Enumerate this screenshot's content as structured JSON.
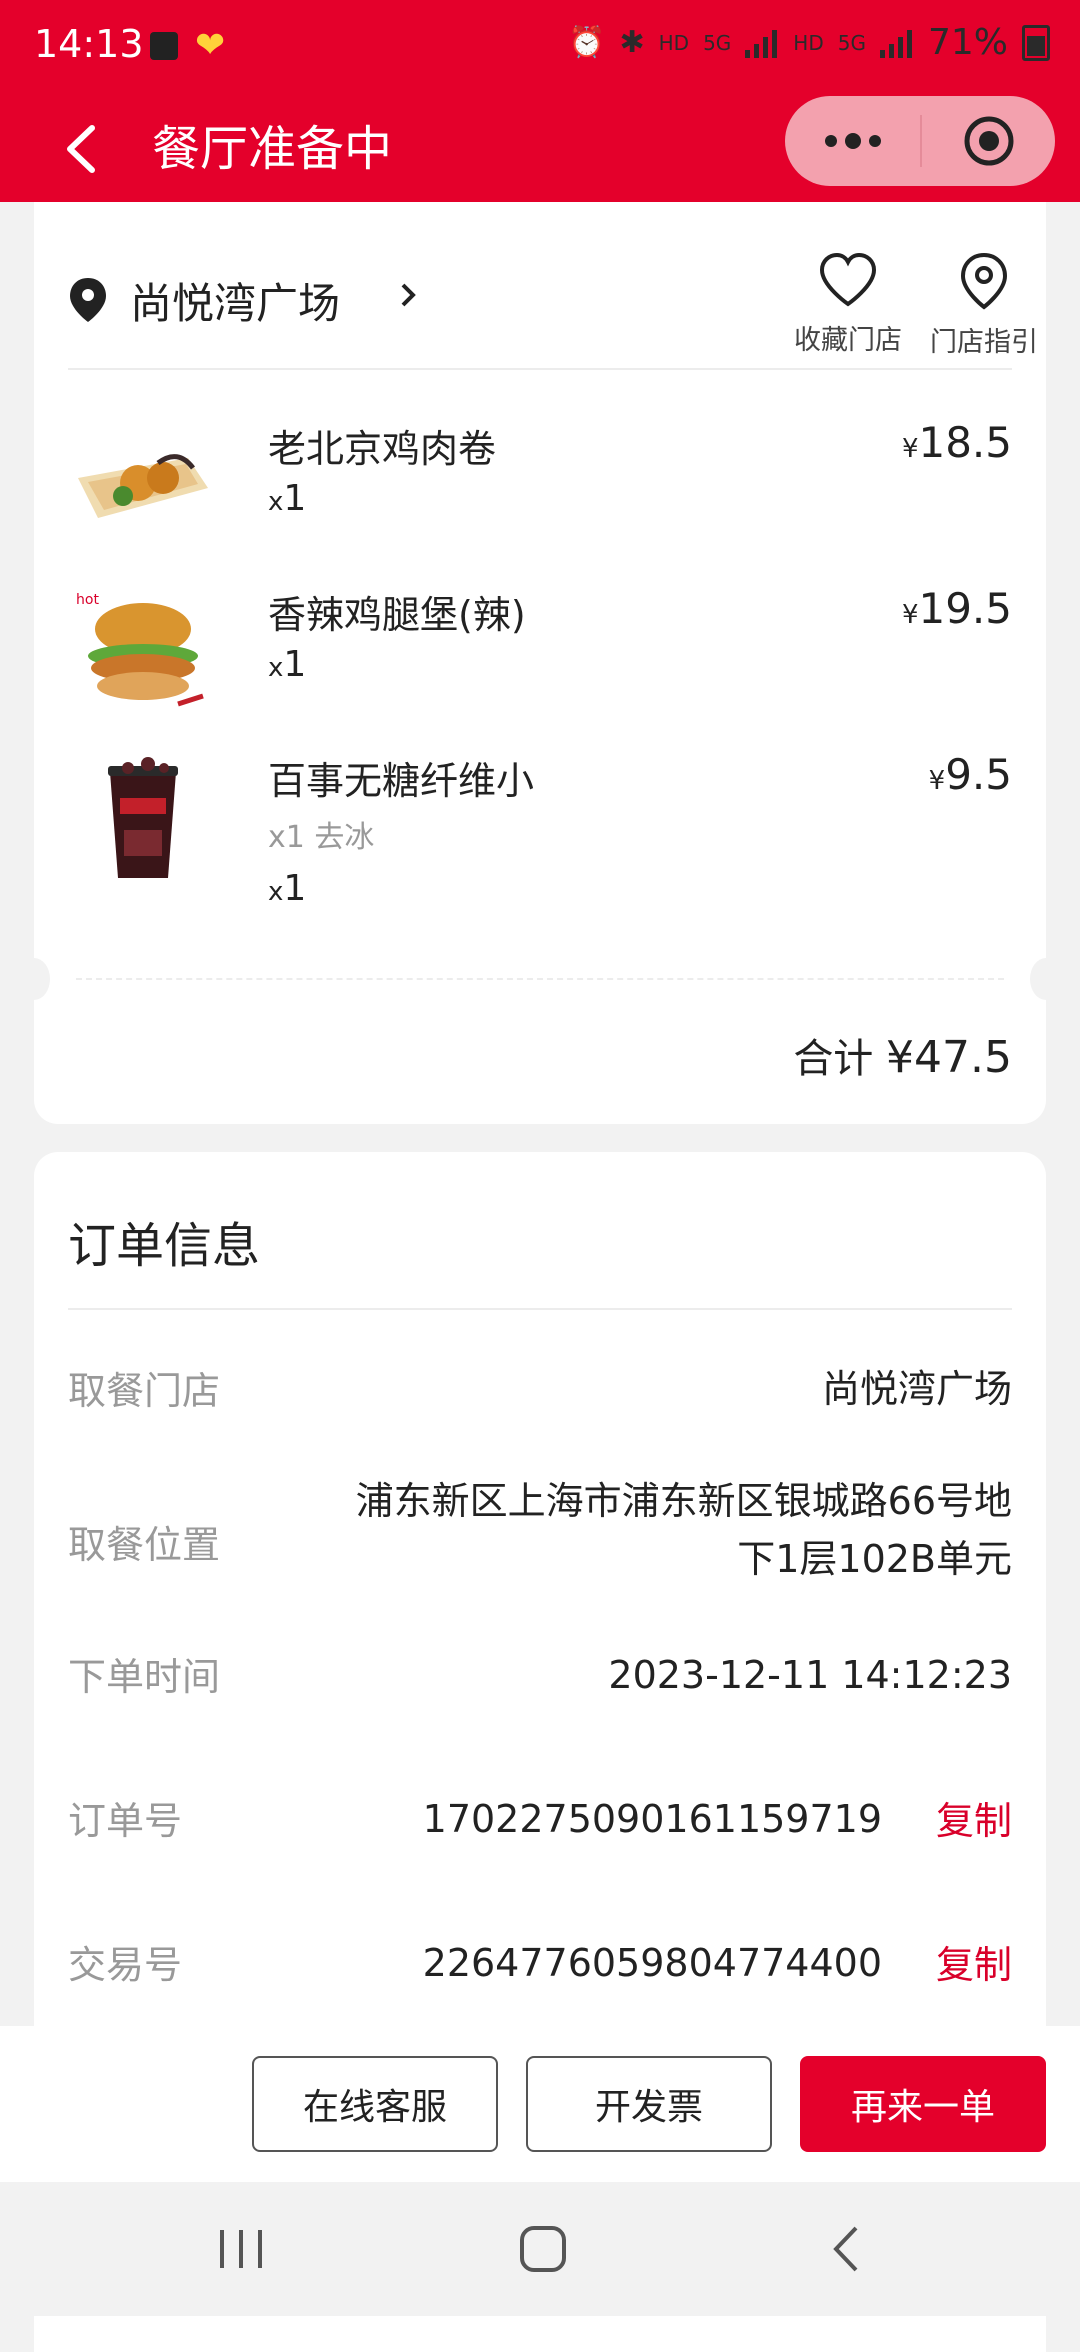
{
  "status_bar": {
    "time": "14:13",
    "net1": "HD",
    "net2": "5G",
    "net3": "HD",
    "net4": "5G",
    "battery": "71%"
  },
  "nav": {
    "title": "餐厅准备中"
  },
  "store": {
    "name": "尚悦湾广场",
    "favorite_label": "收藏门店",
    "guide_label": "门店指引"
  },
  "items": [
    {
      "name": "老北京鸡肉卷",
      "price": "18.5",
      "qty": "1",
      "option": ""
    },
    {
      "name": "香辣鸡腿堡(辣)",
      "price": "19.5",
      "qty": "1",
      "option": ""
    },
    {
      "name": "百事无糖纤维小",
      "price": "9.5",
      "qty": "1",
      "option": "x1 去冰"
    }
  ],
  "currency": "¥",
  "qty_prefix": "x",
  "total": {
    "label": "合计",
    "amount": "¥47.5"
  },
  "order_info": {
    "title": "订单信息",
    "rows": [
      {
        "label": "取餐门店",
        "value": "尚悦湾广场"
      },
      {
        "label": "取餐位置",
        "value_line1": "浦东新区上海市浦东新区银城路66号地",
        "value_line2": "下1层102B单元"
      },
      {
        "label": "下单时间",
        "value": "2023-12-11 14:12:23"
      },
      {
        "label": "订单号",
        "value": "1702275090161159719",
        "action": "复制"
      },
      {
        "label": "交易号",
        "value": "2264776059804774400",
        "action": "复制"
      }
    ]
  },
  "actions": {
    "service": "在线客服",
    "invoice": "开发票",
    "reorder": "再来一单"
  },
  "colors": {
    "brand": "#e4002b",
    "link": "#d9002a"
  }
}
